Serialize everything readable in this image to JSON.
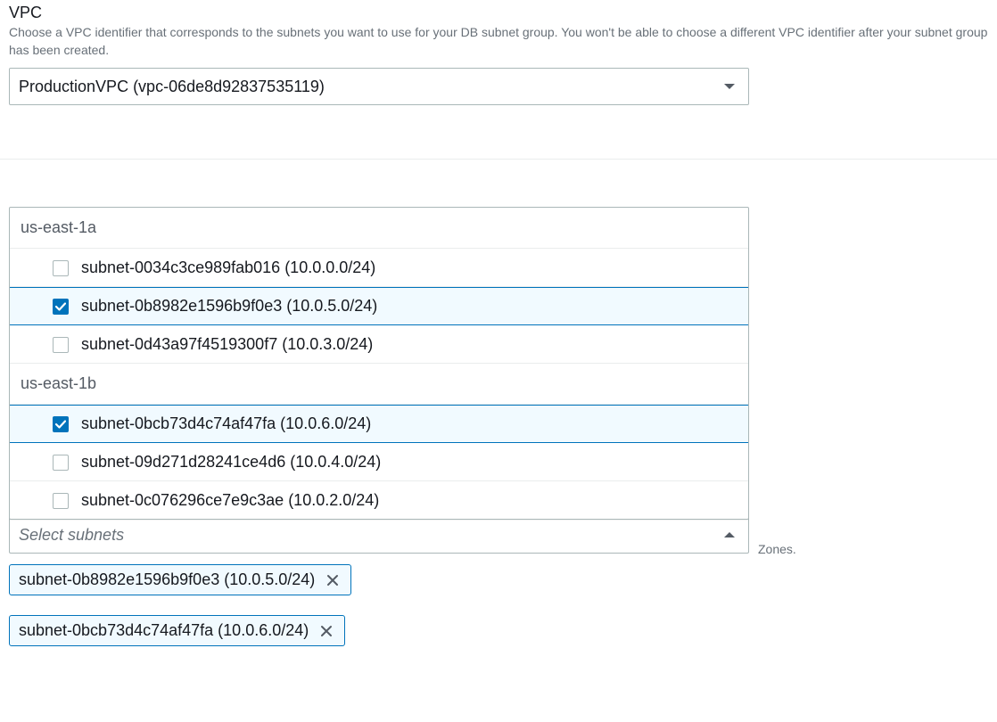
{
  "vpc_section": {
    "label": "VPC",
    "description": "Choose a VPC identifier that corresponds to the subnets you want to use for your DB subnet group. You won't be able to choose a different VPC identifier after your subnet group has been created.",
    "selected_value": "ProductionVPC (vpc-06de8d92837535119)"
  },
  "subnet_dropdown": {
    "groups": [
      {
        "header": "us-east-1a",
        "options": [
          {
            "label": "subnet-0034c3ce989fab016 (10.0.0.0/24)",
            "checked": false
          },
          {
            "label": "subnet-0b8982e1596b9f0e3 (10.0.5.0/24)",
            "checked": true
          },
          {
            "label": "subnet-0d43a97f4519300f7 (10.0.3.0/24)",
            "checked": false
          }
        ]
      },
      {
        "header": "us-east-1b",
        "options": [
          {
            "label": "subnet-0bcb73d4c74af47fa (10.0.6.0/24)",
            "checked": true
          },
          {
            "label": "subnet-09d271d28241ce4d6 (10.0.4.0/24)",
            "checked": false
          },
          {
            "label": "subnet-0c076296ce7e9c3ae (10.0.2.0/24)",
            "checked": false
          }
        ]
      }
    ],
    "placeholder": "Select subnets"
  },
  "selected_tokens": [
    {
      "label": "subnet-0b8982e1596b9f0e3 (10.0.5.0/24)"
    },
    {
      "label": "subnet-0bcb73d4c74af47fa (10.0.6.0/24)"
    }
  ],
  "background_hint": "Zones."
}
